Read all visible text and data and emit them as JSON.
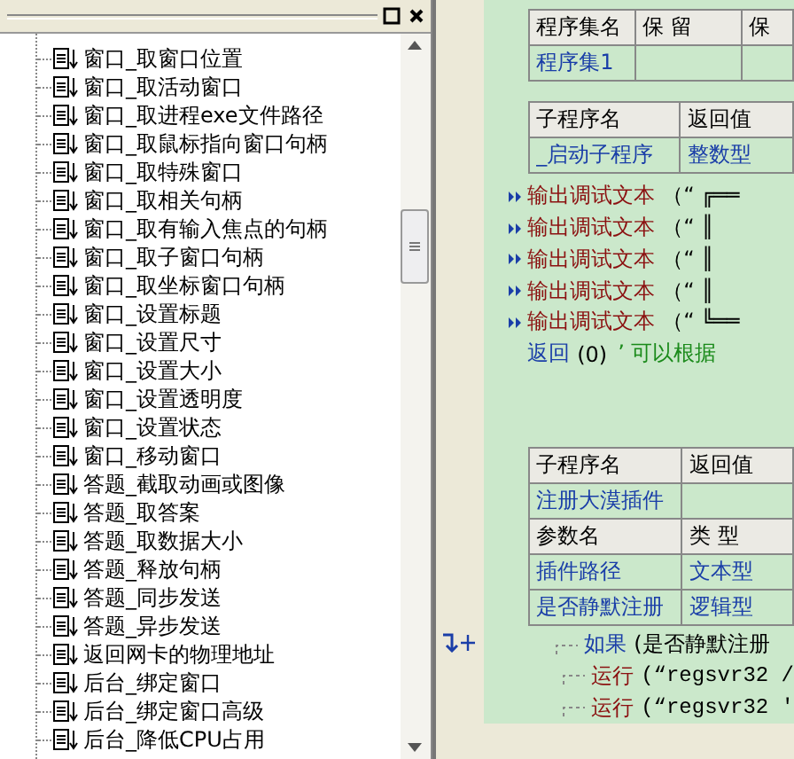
{
  "tree": {
    "items": [
      {
        "label": "窗口_取窗口位置"
      },
      {
        "label": "窗口_取活动窗口"
      },
      {
        "label": "窗口_取进程exe文件路径"
      },
      {
        "label": "窗口_取鼠标指向窗口句柄"
      },
      {
        "label": "窗口_取特殊窗口"
      },
      {
        "label": "窗口_取相关句柄"
      },
      {
        "label": "窗口_取有输入焦点的句柄"
      },
      {
        "label": "窗口_取子窗口句柄"
      },
      {
        "label": "窗口_取坐标窗口句柄"
      },
      {
        "label": "窗口_设置标题"
      },
      {
        "label": "窗口_设置尺寸"
      },
      {
        "label": "窗口_设置大小"
      },
      {
        "label": "窗口_设置透明度"
      },
      {
        "label": "窗口_设置状态"
      },
      {
        "label": "窗口_移动窗口"
      },
      {
        "label": "答题_截取动画或图像"
      },
      {
        "label": "答题_取答案"
      },
      {
        "label": "答题_取数据大小"
      },
      {
        "label": "答题_释放句柄"
      },
      {
        "label": "答题_同步发送"
      },
      {
        "label": "答题_异步发送"
      },
      {
        "label": "返回网卡的物理地址"
      },
      {
        "label": "后台_绑定窗口"
      },
      {
        "label": "后台_绑定窗口高级"
      },
      {
        "label": "后台_降低CPU占用"
      }
    ]
  },
  "editor": {
    "assembly_table": {
      "rows": [
        [
          "程序集名",
          "保 留",
          "保"
        ],
        [
          "程序集1",
          "",
          ""
        ]
      ]
    },
    "sub_table": {
      "rows": [
        [
          "子程序名",
          "返回值"
        ],
        [
          "_启动子程序",
          "整数型"
        ]
      ]
    },
    "lines": [
      {
        "kind": "call",
        "keyword": "输出调试文本",
        "args": "（“ ╔══"
      },
      {
        "kind": "call",
        "keyword": "输出调试文本",
        "args": "（“ ║"
      },
      {
        "kind": "call",
        "keyword": "输出调试文本",
        "args": "（“ ║"
      },
      {
        "kind": "call",
        "keyword": "输出调试文本",
        "args": "（“ ║"
      },
      {
        "kind": "call",
        "keyword": "输出调试文本",
        "args": "（“ ╚══"
      },
      {
        "kind": "return",
        "keyword": "返回",
        "args": "(0)",
        "comment": "’ 可以根据"
      }
    ],
    "sub_table2": {
      "rows": [
        [
          "子程序名",
          "返回值"
        ],
        [
          "注册大漠插件",
          ""
        ],
        [
          "参数名",
          "类 型"
        ],
        [
          "插件路径",
          "文本型"
        ],
        [
          "是否静默注册",
          "逻辑型"
        ]
      ]
    },
    "flow": [
      {
        "kind": "if",
        "keyword": "如果",
        "args": "(是否静默注册"
      },
      {
        "kind": "run",
        "keyword": "运行",
        "args": "(“regsvr32 /"
      },
      {
        "kind": "run",
        "keyword": "运行",
        "args": "(“regsvr32 '"
      }
    ]
  }
}
